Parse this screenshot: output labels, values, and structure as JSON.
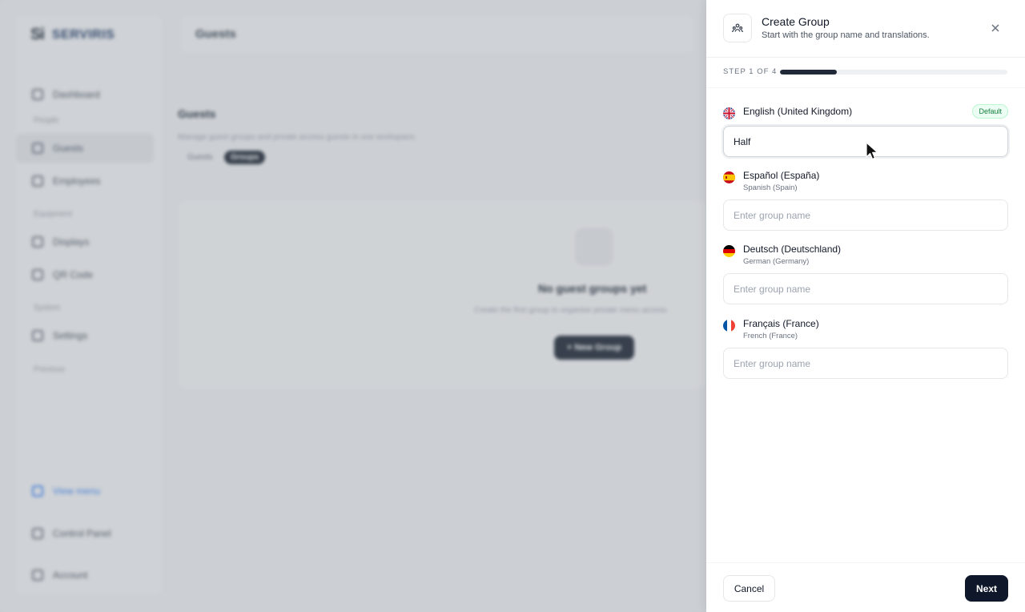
{
  "background": {
    "logo_mark": "Si",
    "logo_word": "SERVIRIS",
    "topbar_title": "Guests",
    "nav": {
      "dashboard": "Dashboard",
      "section_people": "People",
      "guests": "Guests",
      "employees": "Employees",
      "section_equipment": "Equipment",
      "displays": "Displays",
      "qr_code": "QR Code",
      "section_system": "System",
      "settings": "Settings",
      "collapse": "Previous",
      "view_menu": "View menu",
      "control_panel": "Control Panel",
      "account": "Account"
    },
    "page_title": "Guests",
    "page_description": "Manage guest groups and private access guests in one workspace.",
    "tabs": [
      "Guests",
      "Groups"
    ],
    "empty_title": "No guest groups yet",
    "empty_description": "Create the first group to organise private menu access",
    "new_group_button": "+ New Group"
  },
  "drawer": {
    "title": "Create Group",
    "subtitle": "Start with the group name and translations.",
    "step_label": "STEP 1 OF 4",
    "progress_fraction": 0.25,
    "languages": [
      {
        "name": "English (United Kingdom)",
        "native": "",
        "badge": "Default",
        "value": "Half",
        "placeholder": "Enter group name",
        "flag": "gb"
      },
      {
        "name": "Español (España)",
        "native": "Spanish (Spain)",
        "value": "",
        "placeholder": "Enter group name",
        "flag": "es"
      },
      {
        "name": "Deutsch (Deutschland)",
        "native": "German (Germany)",
        "value": "",
        "placeholder": "Enter group name",
        "flag": "de"
      },
      {
        "name": "Français (France)",
        "native": "French (France)",
        "value": "",
        "placeholder": "Enter group name",
        "flag": "fr"
      }
    ],
    "cancel_label": "Cancel",
    "next_label": "Next"
  },
  "colors": {
    "primary_dark": "#0f172a",
    "badge_green": "#15803d"
  }
}
